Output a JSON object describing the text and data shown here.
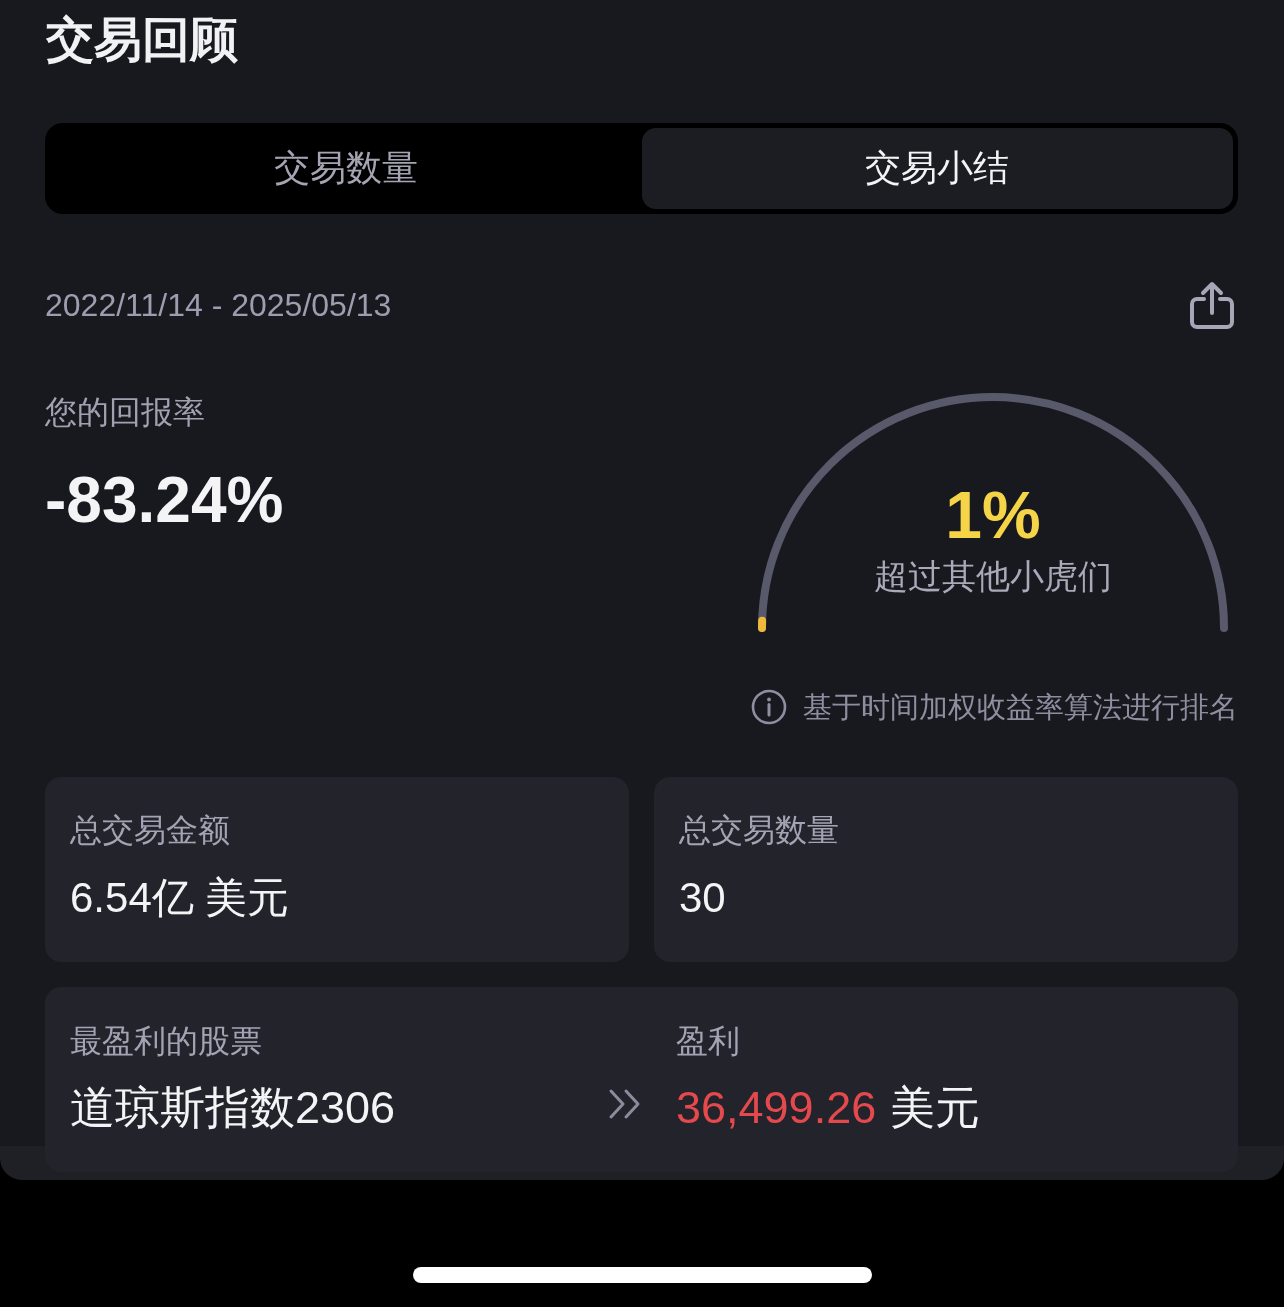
{
  "title": "交易回顾",
  "tabs": [
    {
      "label": "交易数量",
      "selected": false
    },
    {
      "label": "交易小结",
      "selected": true
    }
  ],
  "period": {
    "date_range": "2022/11/14 - 2025/05/13"
  },
  "return": {
    "label": "您的回报率",
    "value": "-83.24%"
  },
  "ranking": {
    "value": "1%",
    "label": "超过其他小虎们",
    "level": 0.01,
    "note": "基于时间加权收益率算法进行排名"
  },
  "stats": [
    {
      "label": "总交易金额",
      "value": "6.54亿 美元"
    },
    {
      "label": "总交易数量",
      "value": "30"
    }
  ],
  "top_stock": {
    "label": "最盈利的股票",
    "name": "道琼斯指数2306",
    "profit_label": "盈利",
    "profit_amount": "36,499.26",
    "profit_currency": "美元"
  }
}
